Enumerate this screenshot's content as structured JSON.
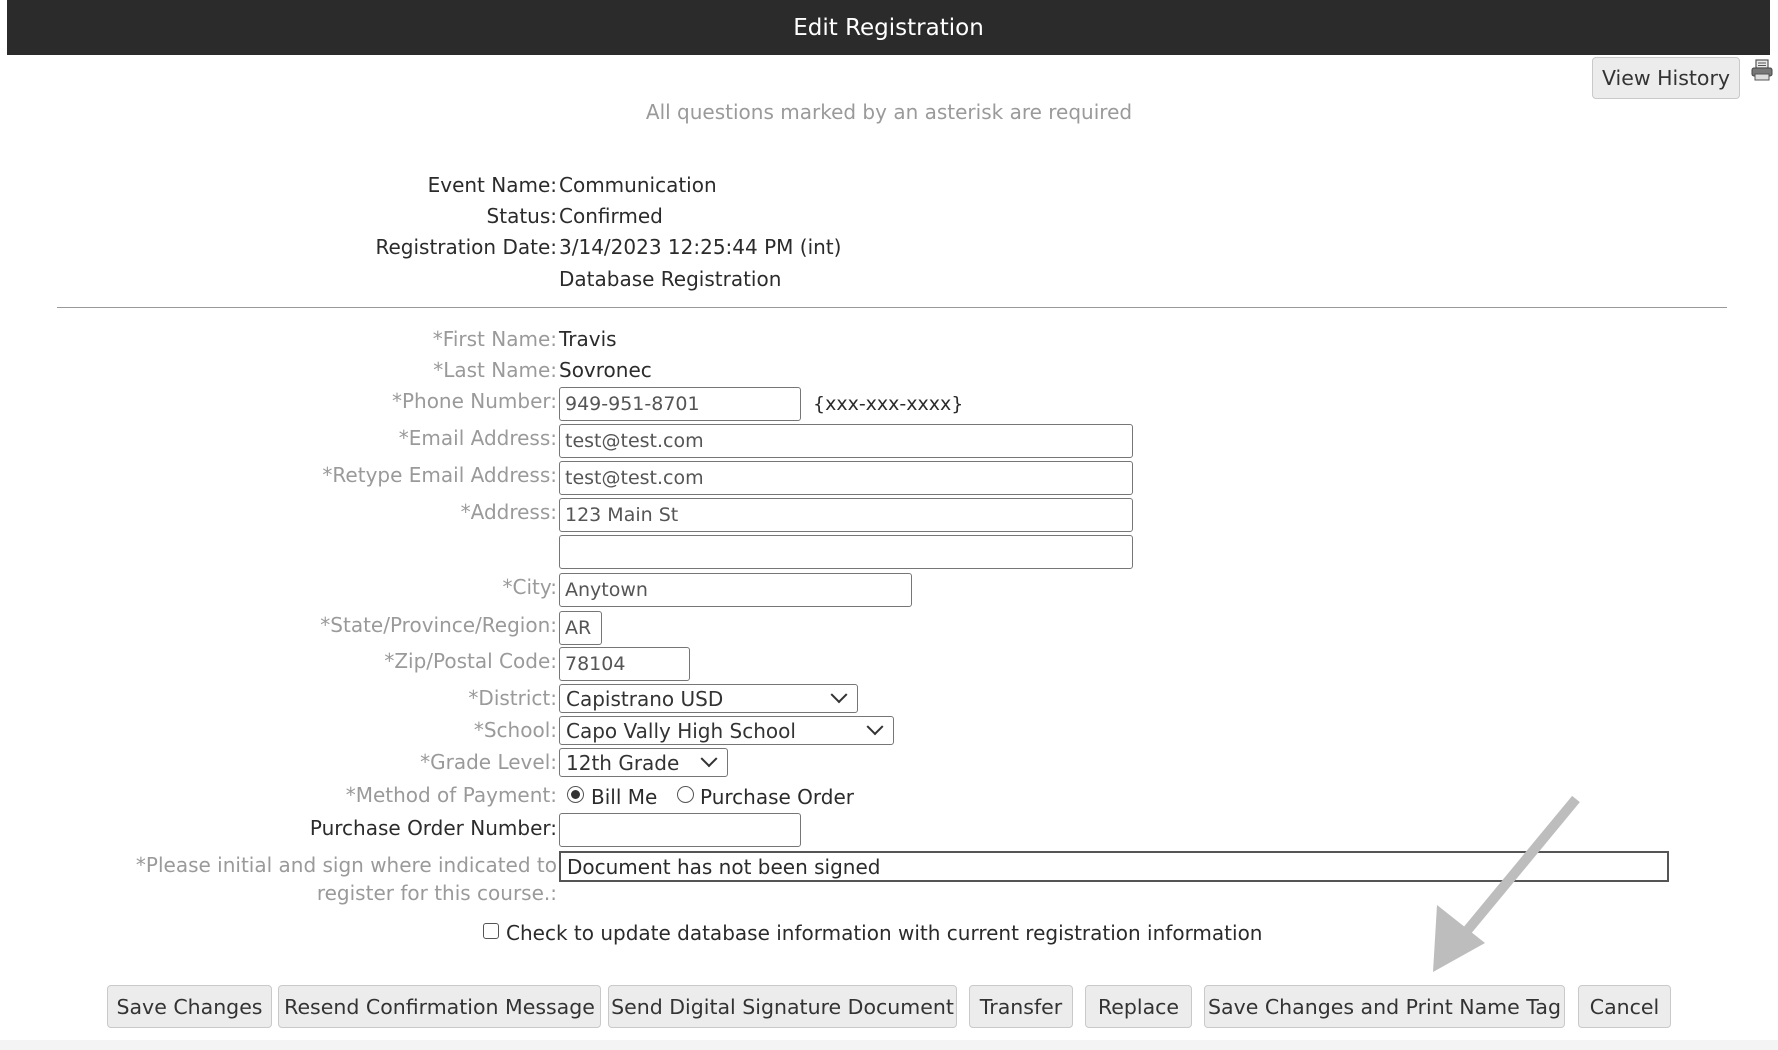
{
  "header": {
    "title": "Edit Registration"
  },
  "toolbar": {
    "view_history_label": "View History",
    "print_icon": "printer-icon"
  },
  "required_note": "All questions marked by an asterisk are required",
  "info": {
    "event_name_label": "Event Name:",
    "event_name": "Communication",
    "status_label": "Status:",
    "status": "Confirmed",
    "registration_date_label": "Registration Date:",
    "registration_date": "3/14/2023 12:25:44 PM (int)",
    "source": "Database Registration"
  },
  "form": {
    "first_name_label": "*First Name:",
    "first_name": "Travis",
    "last_name_label": "*Last Name:",
    "last_name": "Sovronec",
    "phone_label": "*Phone Number:",
    "phone": "949-951-8701",
    "phone_hint": "{xxx-xxx-xxxx}",
    "email_label": "*Email Address:",
    "email": "test@test.com",
    "retype_email_label": "*Retype Email Address:",
    "retype_email": "test@test.com",
    "address_label": "*Address:",
    "address1": "123 Main St",
    "address2": "",
    "city_label": "*City:",
    "city": "Anytown",
    "state_label": "*State/Province/Region:",
    "state": "AR",
    "zip_label": "*Zip/Postal Code:",
    "zip": "78104",
    "district_label": "*District:",
    "district": "Capistrano USD",
    "school_label": "*School:",
    "school": "Capo Vally High School",
    "grade_label": "*Grade Level:",
    "grade": "12th Grade",
    "payment_label": "*Method of Payment:",
    "payment_options": [
      {
        "label": "Bill Me",
        "selected": true
      },
      {
        "label": "Purchase Order",
        "selected": false
      }
    ],
    "po_number_label": "Purchase Order Number:",
    "po_number": "",
    "signature_label_line1": "*Please initial and sign where indicated to",
    "signature_label_line2": "register for this course.:",
    "signature_status": "Document has not been signed",
    "update_db_label": "Check to update database information with current registration information",
    "update_db_checked": false
  },
  "actions": [
    "Save Changes",
    "Resend Confirmation Message",
    "Send Digital Signature Document",
    "Transfer",
    "Replace",
    "Save Changes and Print Name Tag",
    "Cancel"
  ],
  "annotation": {
    "arrow_target": "Save Changes and Print Name Tag",
    "arrow_color": "#bdbdbd"
  }
}
